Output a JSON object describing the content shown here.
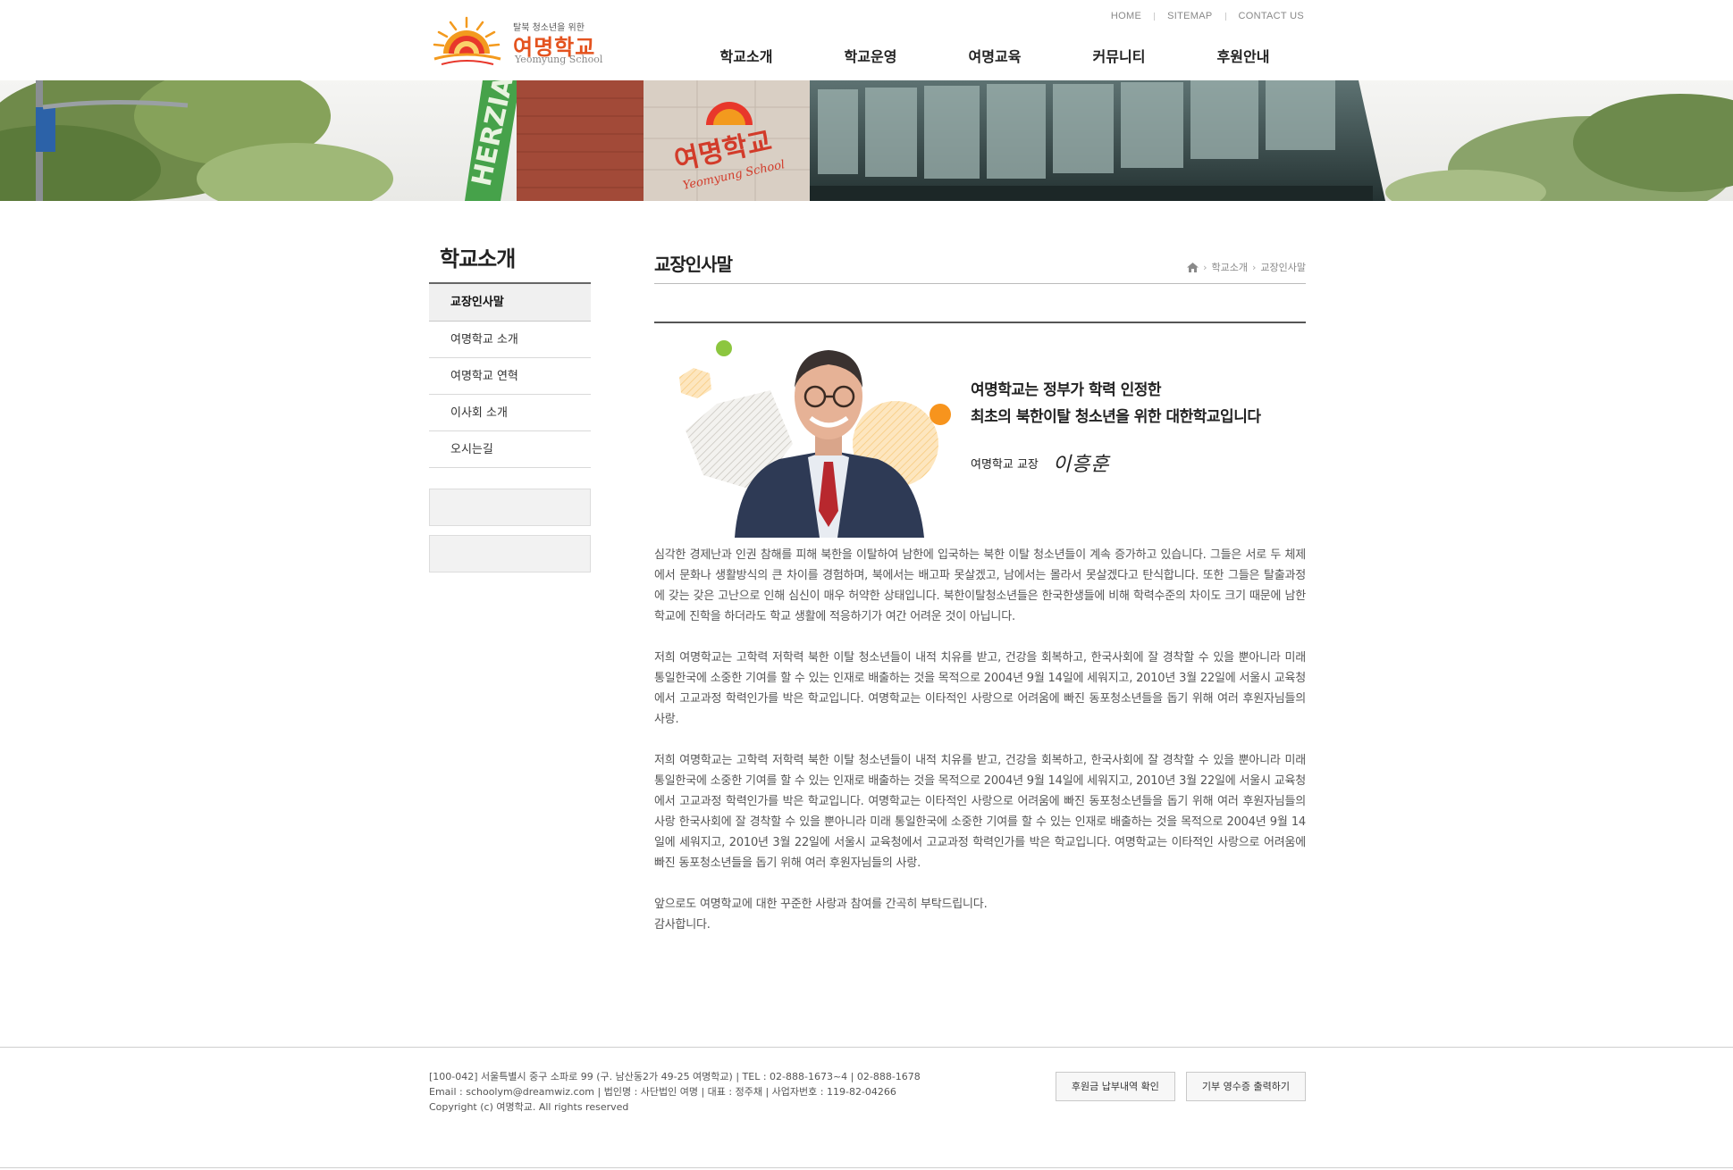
{
  "header": {
    "logo": {
      "tagline": "탈북 청소년을 위한",
      "name": "여명학교",
      "name_en": "Yeomyung School"
    },
    "util_links": [
      "HOME",
      "SITEMAP",
      "CONTACT US"
    ],
    "gnb": [
      "학교소개",
      "학교운영",
      "여명교육",
      "커뮤니티",
      "후원안내"
    ]
  },
  "banner": {
    "sign_text": "여명학교",
    "sign_text_en": "Yeomyung School",
    "wall_text": "HERZIA"
  },
  "sidebar": {
    "title": "학교소개",
    "items": [
      {
        "label": "교장인사말",
        "active": true
      },
      {
        "label": "여명학교 소개",
        "active": false
      },
      {
        "label": "여명학교 연혁",
        "active": false
      },
      {
        "label": "이사회 소개",
        "active": false
      },
      {
        "label": "오시는길",
        "active": false
      }
    ]
  },
  "content": {
    "title": "교장인사말",
    "breadcrumb": [
      "학교소개",
      "교장인사말"
    ],
    "quote_line1": "여명학교는 정부가 학력 인정한",
    "quote_line2": "최초의 북한이탈 청소년을 위한 대한학교입니다",
    "signature_label": "여명학교 교장",
    "signature_name": "이흥훈",
    "paragraphs": [
      "심각한 경제난과 인권 참해를 피해 북한을 이탈하여 남한에 입국하는 북한 이탈 청소년들이 계속 증가하고 있습니다. 그들은 서로 두 체제에서 문화나 생활방식의 큰 차이를 경험하며, 북에서는 배고파 못살겠고, 남에서는 몰라서 못살겠다고 탄식합니다. 또한 그들은 탈출과정에 갖는 갖은 고난으로 인해 심신이 매우 허약한 상태입니다. 북한이탈청소년들은 한국한생들에 비해 학력수준의 차이도 크기 때문에 남한 학교에 진학을 하더라도 학교 생활에 적응하기가 여간 어려운 것이 아닙니다.",
      "저희 여명학교는 고학력 저학력 북한 이탈 청소년들이 내적 치유를 받고, 건강을 회복하고, 한국사회에 잘 경착할 수 있을 뿐아니라 미래 통일한국에 소중한 기여를 할 수 있는 인재로 배출하는 것을 목적으로 2004년 9월 14일에 세워지고, 2010년 3월 22일에 서울시 교육청에서 고교과정 학력인가를 박은 학교입니다. 여명학교는 이타적인 사랑으로 어려움에 빠진 동포청소년들을 돕기 위해 여러 후원자님들의 사랑.",
      "저희 여명학교는 고학력 저학력 북한 이탈 청소년들이 내적 치유를 받고, 건강을 회복하고, 한국사회에 잘 경착할 수 있을 뿐아니라 미래 통일한국에 소중한 기여를 할 수 있는 인재로 배출하는 것을 목적으로 2004년 9월 14일에 세워지고, 2010년 3월 22일에 서울시 교육청에서 고교과정 학력인가를 박은 학교입니다. 여명학교는 이타적인 사랑으로 어려움에 빠진 동포청소년들을 돕기 위해 여러 후원자님들의 사랑  한국사회에 잘 경착할 수 있을 뿐아니라 미래 통일한국에 소중한 기여를 할 수 있는 인재로 배출하는 것을 목적으로 2004년 9월 14일에 세워지고, 2010년 3월 22일에 서울시 교육청에서 고교과정 학력인가를 박은 학교입니다. 여명학교는 이타적인 사랑으로 어려움에 빠진 동포청소년들을 돕기 위해 여러 후원자님들의 사랑.",
      "앞으로도 여명학교에 대한 꾸준한 사랑과 참여를 간곡히 부탁드립니다.",
      "감사합니다."
    ]
  },
  "footer": {
    "line1": "[100-042] 서울특별시 중구 소파로 99 (구. 남산동2가 49-25 여명학교) | TEL : 02-888-1673~4 | 02-888-1678",
    "line2": "Email : schoolym@dreamwiz.com | 법인명 : 사단법인 여명 | 대표 : 정주채 | 사업자번호 : 119-82-04266",
    "line3": "Copyright (c) 여명학교. All rights reserved",
    "buttons": [
      "후원금 납부내역 확인",
      "기부 영수증 출력하기"
    ]
  },
  "colors": {
    "brand_orange": "#e4531f",
    "accent_green": "#8cc63f"
  }
}
